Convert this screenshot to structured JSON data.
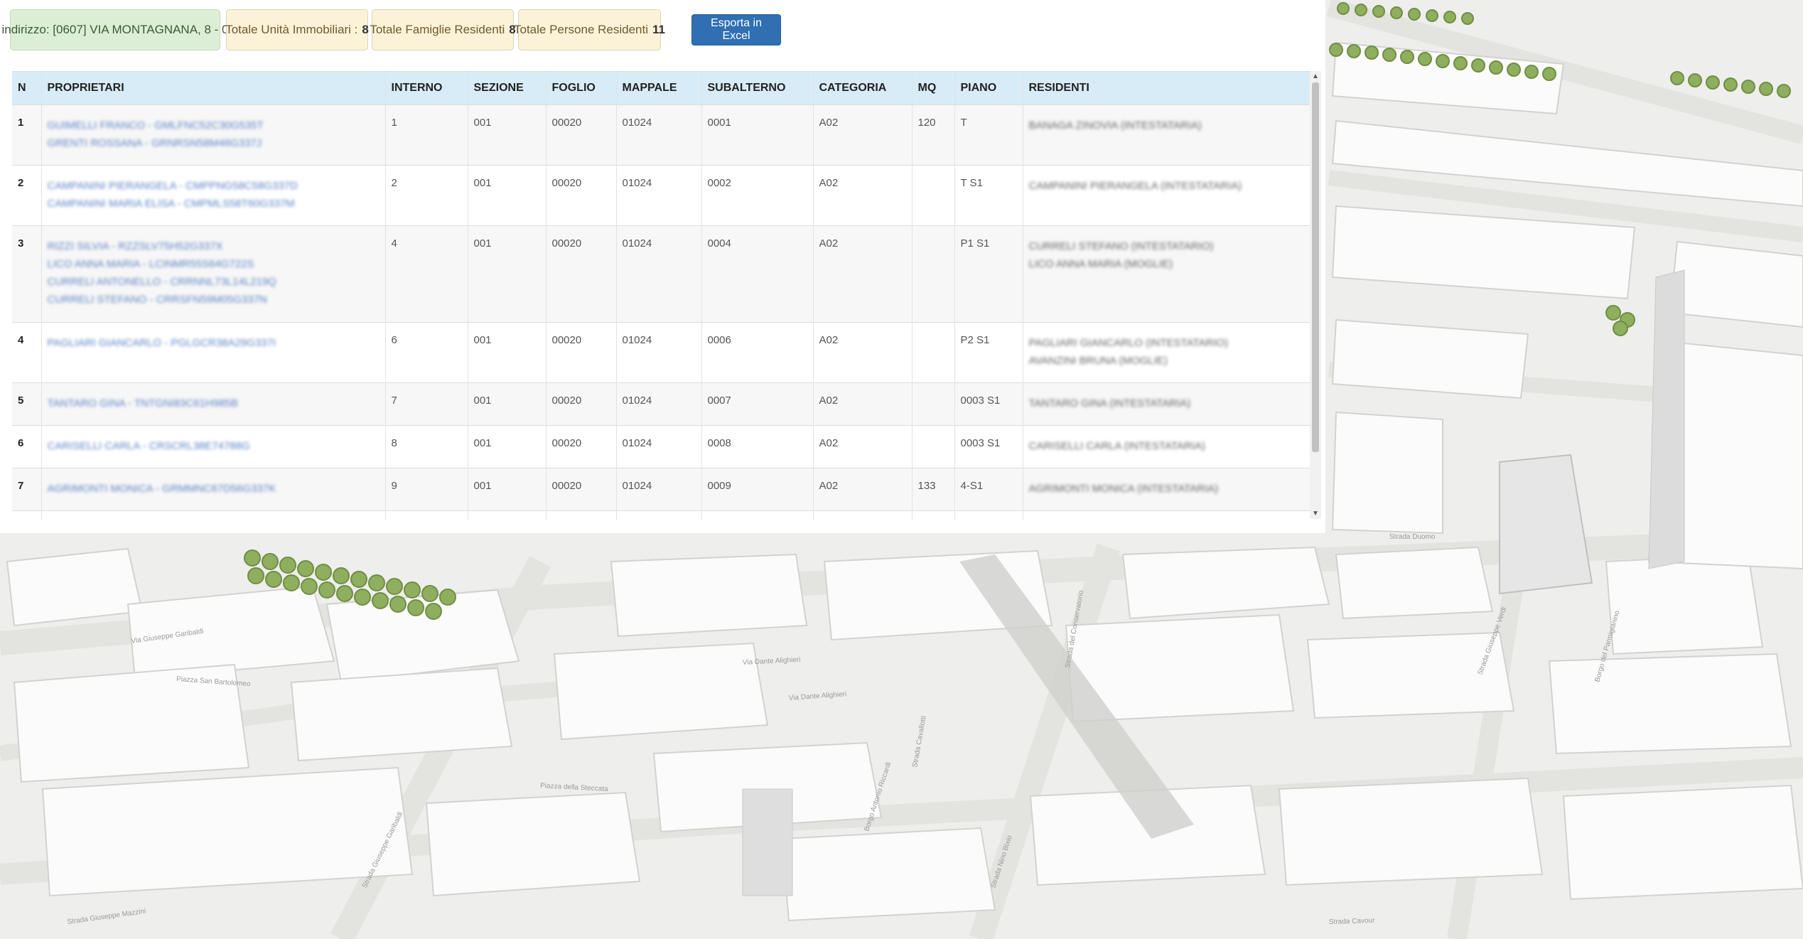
{
  "header": {
    "address": "indirizzo: [0607] VIA MONTAGNANA, 8 - 0",
    "stats": [
      {
        "label": "Totale Unità Immobiliari :",
        "value": "8"
      },
      {
        "label": "Totale Famiglie Residenti",
        "value": "8"
      },
      {
        "label": "Totale Persone Residenti",
        "value": "11"
      }
    ],
    "export_label": "Esporta in Excel"
  },
  "table": {
    "columns": [
      "N",
      "PROPRIETARI",
      "INTERNO",
      "SEZIONE",
      "FOGLIO",
      "MAPPALE",
      "SUBALTERNO",
      "CATEGORIA",
      "MQ",
      "PIANO",
      "RESIDENTI"
    ],
    "rows": [
      {
        "n": "1",
        "owners": [
          "GUIMELLI FRANCO - GMLFNC52C30G535T",
          "GRENTI ROSSANA - GRNRSN58M46G337J"
        ],
        "interno": "1",
        "sezione": "001",
        "foglio": "00020",
        "mappale": "01024",
        "subalterno": "0001",
        "categoria": "A02",
        "mq": "120",
        "piano": "T",
        "residents": [
          "BANAGA ZINOVIA (INTESTATARIA)"
        ]
      },
      {
        "n": "2",
        "owners": [
          "CAMPANINI PIERANGELA - CMPPNG58C58G337D",
          "CAMPANINI MARIA ELISA - CMPMLS58T60G337M"
        ],
        "interno": "2",
        "sezione": "001",
        "foglio": "00020",
        "mappale": "01024",
        "subalterno": "0002",
        "categoria": "A02",
        "mq": "",
        "piano": "T S1",
        "residents": [
          "CAMPANINI PIERANGELA (INTESTATARIA)"
        ]
      },
      {
        "n": "3",
        "owners": [
          "RIZZI SILVIA - RZZSLV75H52G337X",
          "LICO ANNA MARIA - LCINMR55S64G722S",
          "CURRELI ANTONELLO - CRRNNL73L14L219Q",
          "CURRELI STEFANO - CRRSFN59M05G337N"
        ],
        "interno": "4",
        "sezione": "001",
        "foglio": "00020",
        "mappale": "01024",
        "subalterno": "0004",
        "categoria": "A02",
        "mq": "",
        "piano": "P1 S1",
        "residents": [
          "CURRELI STEFANO (INTESTATARIO)",
          "LICO ANNA MARIA (MOGLIE)"
        ]
      },
      {
        "n": "4",
        "owners": [
          "PAGLIARI GIANCARLO - PGLGCR38A29G337I"
        ],
        "interno": "6",
        "sezione": "001",
        "foglio": "00020",
        "mappale": "01024",
        "subalterno": "0006",
        "categoria": "A02",
        "mq": "",
        "piano": "P2 S1",
        "residents": [
          "PAGLIARI GIANCARLO (INTESTATARIO)",
          "AVANZINI BRUNA (MOGLIE)"
        ]
      },
      {
        "n": "5",
        "owners": [
          "TANTARO GINA - TNTGNI83C61H985B"
        ],
        "interno": "7",
        "sezione": "001",
        "foglio": "00020",
        "mappale": "01024",
        "subalterno": "0007",
        "categoria": "A02",
        "mq": "",
        "piano": "0003 S1",
        "residents": [
          "TANTARO GINA (INTESTATARIA)"
        ]
      },
      {
        "n": "6",
        "owners": [
          "CARISELLI CARLA - CRSCRL38E74788G"
        ],
        "interno": "8",
        "sezione": "001",
        "foglio": "00020",
        "mappale": "01024",
        "subalterno": "0008",
        "categoria": "A02",
        "mq": "",
        "piano": "0003 S1",
        "residents": [
          "CARISELLI CARLA (INTESTATARIA)"
        ]
      },
      {
        "n": "7",
        "owners": [
          "AGRIMONTI MONICA - GRMMNC67D56G337K"
        ],
        "interno": "9",
        "sezione": "001",
        "foglio": "00020",
        "mappale": "01024",
        "subalterno": "0009",
        "categoria": "A02",
        "mq": "133",
        "piano": "4-S1",
        "residents": [
          "AGRIMONTI MONICA (INTESTATARIA)"
        ]
      }
    ]
  },
  "map": {
    "streets": [
      "Via Giuseppe Garibaldi",
      "Piazza San Bartolomeo",
      "Via Dante Alighieri",
      "Piazza della Steccata",
      "Strada Giuseppe Mazzini",
      "Strada Giuseppe Garibaldi",
      "Borgo Antonio Riccardi",
      "Strada Cavallotti",
      "Strada Nino Bixio",
      "Strada del Conservatorio",
      "Strada Giuseppe Verdi",
      "Borgo del Parmigianino",
      "Strada Duomo",
      "Strada Cavour",
      "Via Dante Alighieri"
    ]
  }
}
